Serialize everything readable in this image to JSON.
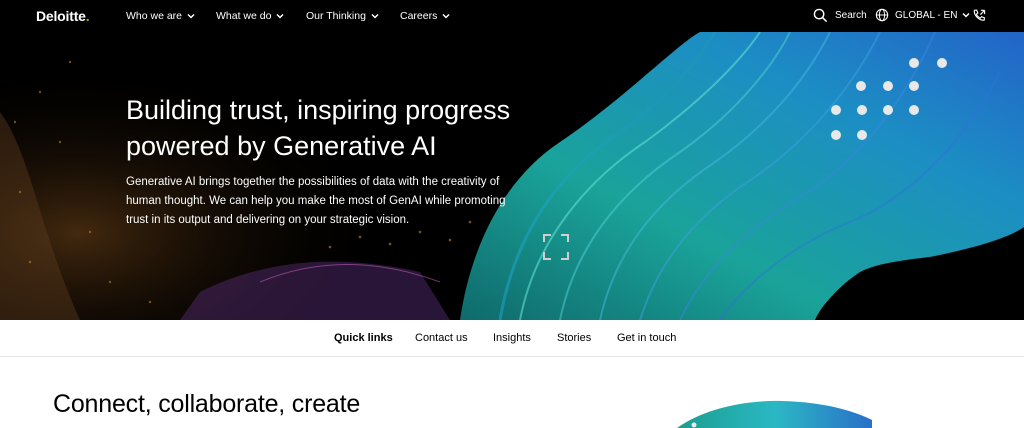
{
  "nav": {
    "logo": "Deloitte",
    "logo_dot": ".",
    "items": [
      {
        "label": "Who we are"
      },
      {
        "label": "What we do"
      },
      {
        "label": "Our Thinking"
      },
      {
        "label": "Careers"
      }
    ],
    "search_label": "Search",
    "region_label": "GLOBAL - EN",
    "icons": [
      "search-icon",
      "globe-icon",
      "chevron-down-icon",
      "phone-icon"
    ]
  },
  "hero": {
    "title": "Building trust, inspiring progress powered by Generative AI",
    "body": "Generative AI brings together the possibilities of data with the creativity of human thought. We can help you make the most of GenAI while promoting trust in its output and delivering on your strategic vision.",
    "icons": [
      "expand-icon"
    ]
  },
  "quick_links": {
    "items": [
      {
        "label": "Quick links"
      },
      {
        "label": "Contact us"
      },
      {
        "label": "Insights"
      },
      {
        "label": "Stories"
      },
      {
        "label": "Get in touch"
      }
    ]
  },
  "section": {
    "title": "Connect, collaborate, create"
  },
  "colors": {
    "brand_green": "#86bc25",
    "hero_bg": "#000000",
    "teal": "#1fb5b0",
    "blue": "#2a7fd4"
  }
}
